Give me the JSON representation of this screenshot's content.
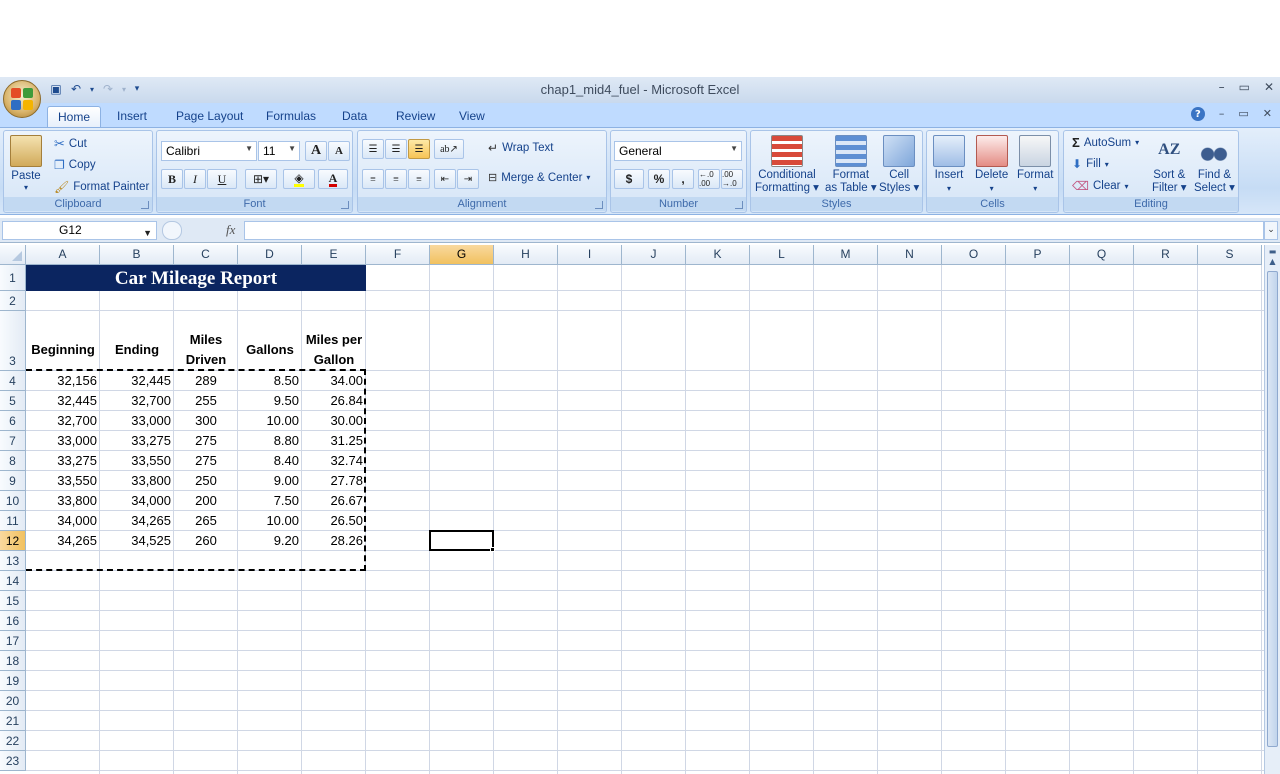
{
  "window": {
    "title": "chap1_mid4_fuel - Microsoft Excel",
    "controls": [
      "–",
      "▭",
      "✕"
    ],
    "workbook_controls": [
      "–",
      "▭",
      "✕"
    ]
  },
  "tabs": [
    "Home",
    "Insert",
    "Page Layout",
    "Formulas",
    "Data",
    "Review",
    "View"
  ],
  "active_tab": "Home",
  "ribbon": {
    "clipboard": {
      "label": "Clipboard",
      "paste": "Paste",
      "cut": "Cut",
      "copy": "Copy",
      "format_painter": "Format Painter"
    },
    "font": {
      "label": "Font",
      "font_name": "Calibri",
      "font_size": "11",
      "bold": "B",
      "italic": "I",
      "underline": "U",
      "grow": "A",
      "shrink": "A",
      "font_color": "A"
    },
    "alignment": {
      "label": "Alignment",
      "wrap_text": "Wrap Text",
      "merge_center": "Merge & Center"
    },
    "number": {
      "label": "Number",
      "format": "General",
      "currency": "$",
      "percent": "%",
      "comma": ",",
      "inc_decimal": "←.0 .00",
      "dec_decimal": ".00 →.0"
    },
    "styles": {
      "label": "Styles",
      "conditional": [
        "Conditional",
        "Formatting"
      ],
      "format_table": [
        "Format",
        "as Table"
      ],
      "cell_styles": [
        "Cell",
        "Styles"
      ]
    },
    "cells": {
      "label": "Cells",
      "insert": "Insert",
      "delete": "Delete",
      "format": "Format"
    },
    "editing": {
      "label": "Editing",
      "autosum": "AutoSum",
      "fill": "Fill",
      "clear": "Clear",
      "sort_filter": [
        "Sort &",
        "Filter"
      ],
      "find_select": [
        "Find &",
        "Select"
      ]
    }
  },
  "formula_bar": {
    "name_box": "G12",
    "fx": "fx",
    "formula": ""
  },
  "columns": [
    "A",
    "B",
    "C",
    "D",
    "E",
    "F",
    "G",
    "H",
    "I",
    "J",
    "K",
    "L",
    "M",
    "N",
    "O",
    "P",
    "Q",
    "R",
    "S"
  ],
  "rows": [
    "1",
    "2",
    "3",
    "4",
    "5",
    "6",
    "7",
    "8",
    "9",
    "10",
    "11",
    "12",
    "13",
    "14",
    "15",
    "16",
    "17",
    "18",
    "19",
    "20",
    "21",
    "22",
    "23"
  ],
  "selected_cell": "G12",
  "sheet": {
    "title": "Car Mileage Report",
    "headers": [
      [
        "Beginning"
      ],
      [
        "Ending"
      ],
      [
        "Miles",
        "Driven"
      ],
      [
        "Gallons"
      ],
      [
        "Miles per",
        "Gallon"
      ]
    ],
    "data": [
      [
        "32,156",
        "32,445",
        "289",
        "8.50",
        "34.00"
      ],
      [
        "32,445",
        "32,700",
        "255",
        "9.50",
        "26.84"
      ],
      [
        "32,700",
        "33,000",
        "300",
        "10.00",
        "30.00"
      ],
      [
        "33,000",
        "33,275",
        "275",
        "8.80",
        "31.25"
      ],
      [
        "33,275",
        "33,550",
        "275",
        "8.40",
        "32.74"
      ],
      [
        "33,550",
        "33,800",
        "250",
        "9.00",
        "27.78"
      ],
      [
        "33,800",
        "34,000",
        "200",
        "7.50",
        "26.67"
      ],
      [
        "34,000",
        "34,265",
        "265",
        "10.00",
        "26.50"
      ],
      [
        "34,265",
        "34,525",
        "260",
        "9.20",
        "28.26"
      ]
    ]
  },
  "colors": {
    "title_fill": "#0b2560",
    "title_text": "#ffffff",
    "header_highlight": "#f1c15f",
    "ribbon_bg": "#c6dcf5"
  }
}
